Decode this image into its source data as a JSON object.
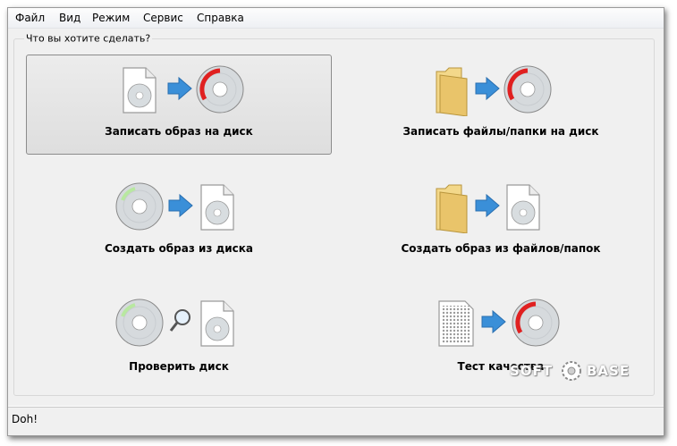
{
  "menu": [
    "Файл",
    "Вид",
    "Режим",
    "Сервис",
    "Справка"
  ],
  "group_title": "Что вы хотите сделать?",
  "actions": [
    {
      "label": "Записать образ на диск",
      "icons": [
        "image-file-icon",
        "arrow-right-icon",
        "burn-disc-icon"
      ],
      "selected": true
    },
    {
      "label": "Записать файлы/папки на диск",
      "icons": [
        "folder-icon",
        "arrow-right-icon",
        "burn-disc-icon"
      ],
      "selected": false
    },
    {
      "label": "Создать образ из диска",
      "icons": [
        "disc-icon",
        "arrow-right-icon",
        "image-file-icon"
      ],
      "selected": false
    },
    {
      "label": "Создать образ из файлов/папок",
      "icons": [
        "folder-icon",
        "arrow-right-icon",
        "image-file-icon"
      ],
      "selected": false
    },
    {
      "label": "Проверить диск",
      "icons": [
        "disc-icon",
        "magnifier-icon",
        "image-file-icon"
      ],
      "selected": false
    },
    {
      "label": "Тест качества",
      "icons": [
        "dotted-document-icon",
        "arrow-right-icon",
        "burn-disc-icon"
      ],
      "selected": false
    }
  ],
  "status": "Doh!",
  "watermark": {
    "left": "SOFT",
    "right": "BASE"
  },
  "colors": {
    "arrow": "#3a8fd8",
    "burn": "#e02020",
    "folder": "#e9c46a",
    "selection_border": "#8c8c8c"
  }
}
